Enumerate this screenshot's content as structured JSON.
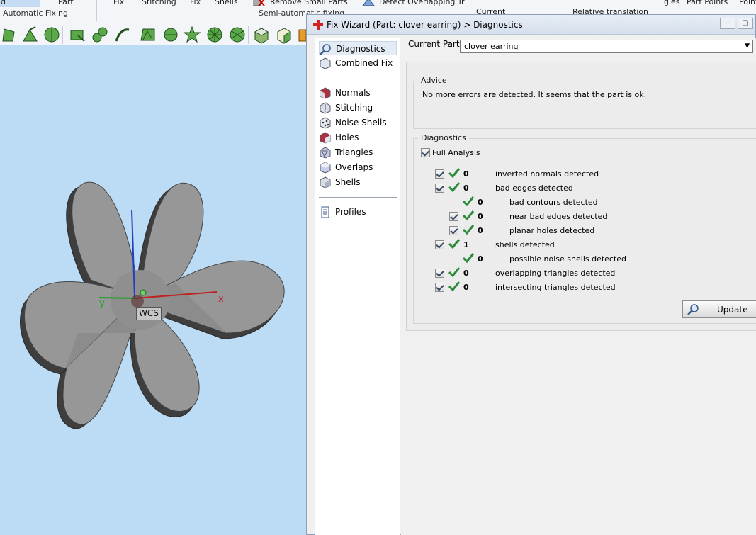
{
  "ribbon": {
    "tabs_top": [
      "d",
      "Part",
      "Fix",
      "Stitching",
      "Fix",
      "Shells",
      "Remove Small Parts",
      "Detect Overlapping Tr",
      "Current",
      "Relative translation",
      "gles",
      "Part Points",
      "Point"
    ],
    "group_automatic": "Automatic Fixing",
    "group_semiautomatic": "Semi-automatic fixing"
  },
  "viewport": {
    "wcs_label": "WCS",
    "axis_x": "x",
    "axis_y": "y"
  },
  "dialog": {
    "title": "Fix Wizard (Part: clover earring) > Diagnostics",
    "minimize_glyph": "—",
    "maximize_glyph": "▢",
    "nav": {
      "diagnostics": "Diagnostics",
      "combined_fix": "Combined Fix",
      "normals": "Normals",
      "stitching": "Stitching",
      "noise_shells": "Noise Shells",
      "holes": "Holes",
      "triangles": "Triangles",
      "overlaps": "Overlaps",
      "shells": "Shells",
      "profiles": "Profiles"
    },
    "current_part_label": "Current Part:",
    "current_part_value": "clover earring",
    "dropdown_arrow": "▼",
    "advice_title": "Advice",
    "advice_text": "No more errors are detected. It seems that the part is ok.",
    "diagnostics_title": "Diagnostics",
    "full_analysis_label": "Full Analysis",
    "rows": [
      {
        "count": "0",
        "label": "inverted normals detected"
      },
      {
        "count": "0",
        "label": "bad edges detected"
      },
      {
        "count": "0",
        "label": "bad contours detected"
      },
      {
        "count": "0",
        "label": "near bad edges detected"
      },
      {
        "count": "0",
        "label": "planar holes detected"
      },
      {
        "count": "1",
        "label": "shells detected"
      },
      {
        "count": "0",
        "label": "possible noise shells detected"
      },
      {
        "count": "0",
        "label": "overlapping triangles detected"
      },
      {
        "count": "0",
        "label": "intersecting triangles detected"
      }
    ],
    "update_label": "Update"
  },
  "colors": {
    "viewport_bg": "#bcdcf6",
    "check_green": "#2e8b3c",
    "ribbon_icon_green": "#4a9a3a"
  }
}
